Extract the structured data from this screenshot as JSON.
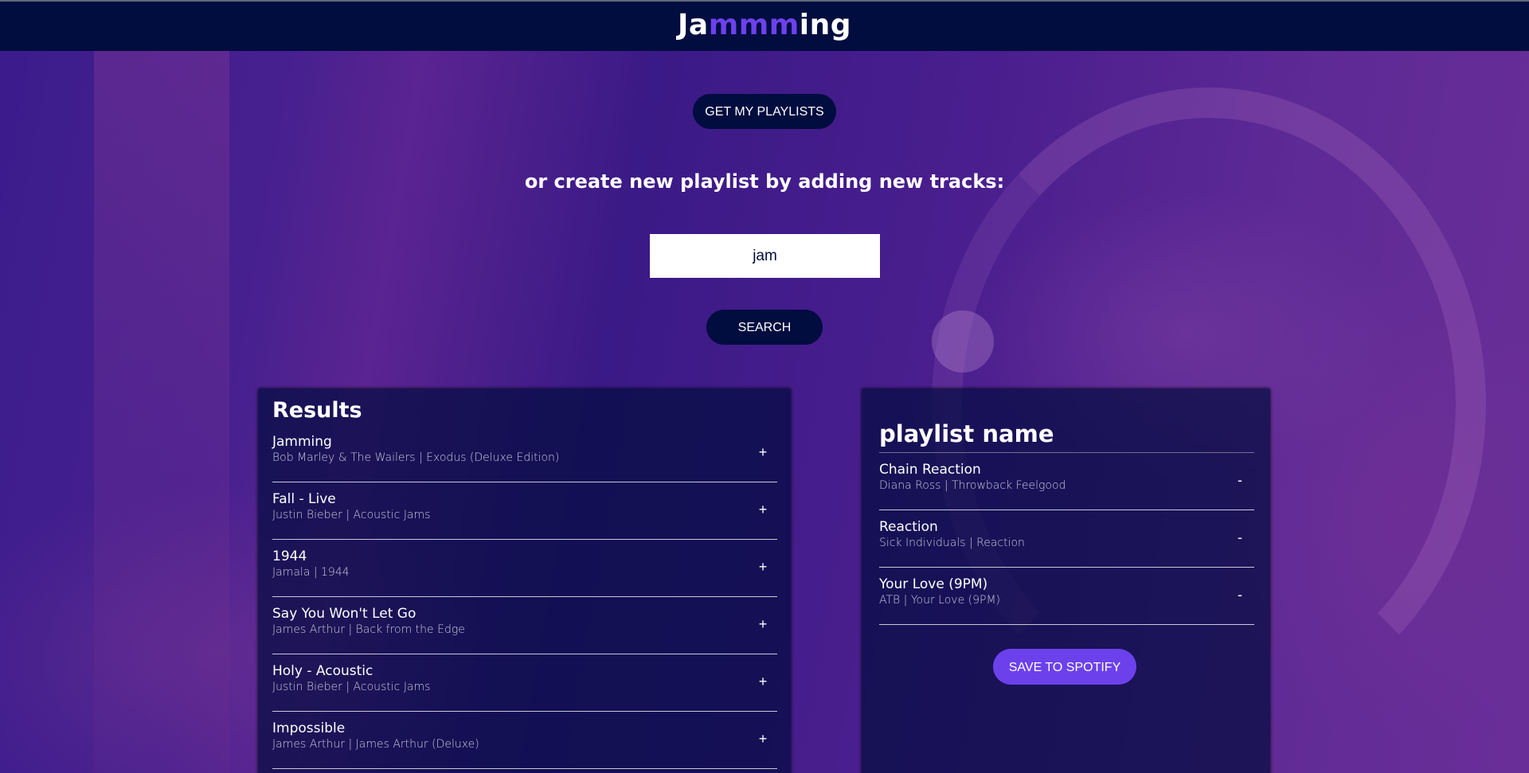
{
  "app": {
    "logo_prefix": "Ja",
    "logo_highlight": "mmm",
    "logo_suffix": "ing"
  },
  "actions": {
    "get_playlists_label": "GET MY PLAYLISTS",
    "subtitle": "or create new playlist by adding new tracks:",
    "search_value": "jam",
    "search_label": "SEARCH"
  },
  "results": {
    "title": "Results",
    "add_symbol": "+",
    "tracks": [
      {
        "name": "Jamming",
        "meta": "Bob Marley & The Wailers | Exodus (Deluxe Edition)"
      },
      {
        "name": "Fall - Live",
        "meta": "Justin Bieber | Acoustic Jams"
      },
      {
        "name": "1944",
        "meta": "Jamala | 1944"
      },
      {
        "name": "Say You Won't Let Go",
        "meta": "James Arthur | Back from the Edge"
      },
      {
        "name": "Holy - Acoustic",
        "meta": "Justin Bieber | Acoustic Jams"
      },
      {
        "name": "Impossible",
        "meta": "James Arthur | James Arthur (Deluxe)"
      }
    ]
  },
  "playlist": {
    "name_value": "playlist name",
    "remove_symbol": "-",
    "tracks": [
      {
        "name": "Chain Reaction",
        "meta": "Diana Ross | Throwback Feelgood"
      },
      {
        "name": "Reaction",
        "meta": "Sick Individuals | Reaction"
      },
      {
        "name": "Your Love (9PM)",
        "meta": "ATB | Your Love (9PM)"
      }
    ],
    "save_label": "SAVE TO SPOTIFY"
  },
  "colors": {
    "navy": "#010c3f",
    "accent": "#6c41ec",
    "background": "#3a1a8a"
  }
}
